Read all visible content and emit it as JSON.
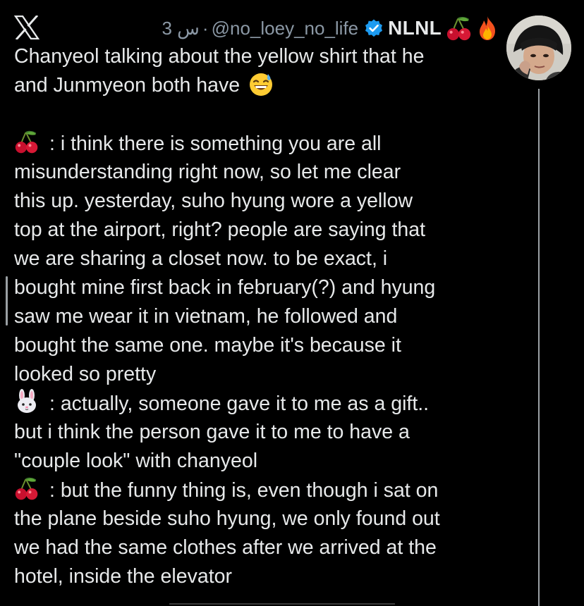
{
  "header": {
    "platform_icon": "x-logo-icon",
    "time": "3 س",
    "separator": "·",
    "handle": "@no_loey_no_life",
    "verified_icon": "verified-badge-icon",
    "display_name": "NLNL",
    "name_emojis": [
      "cherry",
      "fire"
    ]
  },
  "tweet": {
    "intro_lines": [
      "Chanyeol talking about the yellow shirt that he",
      "and Junmyeon both have"
    ],
    "intro_emoji": "grinning-sweat-emoji",
    "block1_lines": [
      ": i think there is something you are all",
      "misunderstanding right now, so let me clear",
      "this up. yesterday, suho hyung wore a yellow",
      "top at the airport, right? people are saying that",
      "we are sharing a closet now. to be exact, i",
      "bought mine first back in february(?) and hyung",
      "saw me wear it in vietnam, he followed and",
      "bought the same one. maybe it's because it",
      "looked so pretty"
    ],
    "block2_lines": [
      ": actually, someone gave it to me as a gift..",
      "but i think the person gave it to me to have a",
      "\"couple look\" with chanyeol"
    ],
    "block3_lines": [
      ": but the funny thing is, even though i sat on",
      "the plane beside suho hyung, we only found out",
      "we had the same clothes after we arrived at the",
      "hotel, inside the elevator"
    ]
  },
  "colors": {
    "background": "#000000",
    "text": "#e7e9ea",
    "muted": "#8b98a5",
    "verified": "#1d9bf0"
  }
}
